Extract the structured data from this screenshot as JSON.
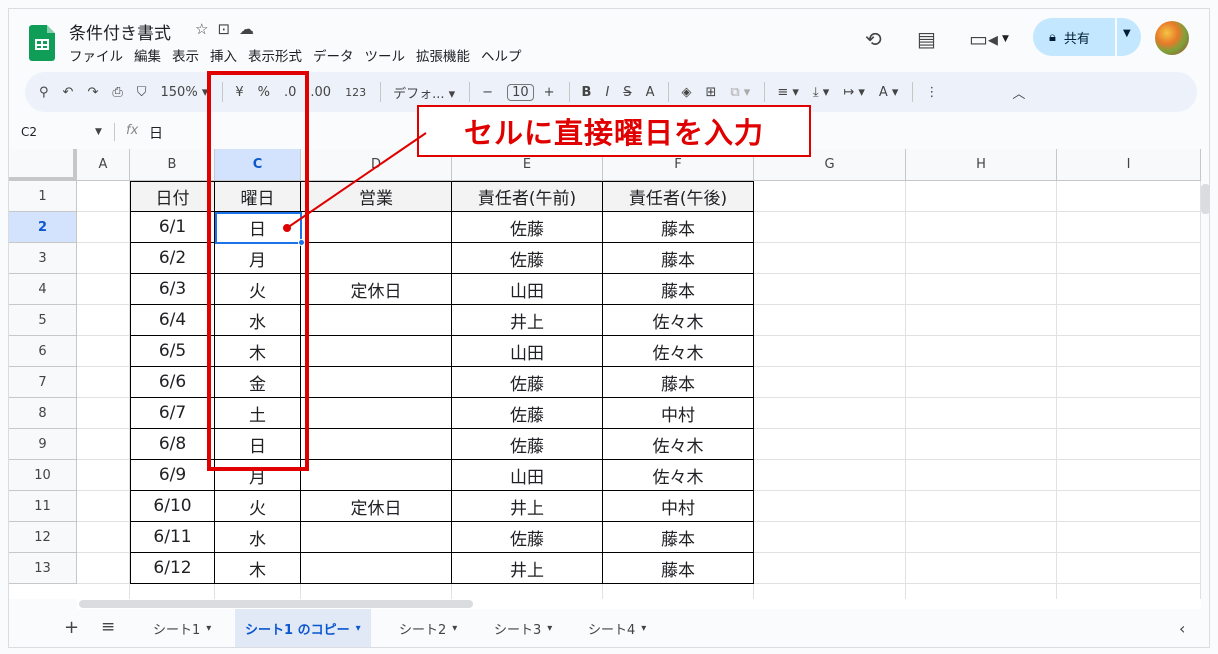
{
  "doc": {
    "title": "条件付き書式",
    "title_icons": [
      "star-icon",
      "move-folder-icon",
      "cloud-status-icon"
    ]
  },
  "menu": [
    "ファイル",
    "編集",
    "表示",
    "挿入",
    "表示形式",
    "データ",
    "ツール",
    "拡張機能",
    "ヘルプ"
  ],
  "share": {
    "label": "共有"
  },
  "toolbar": {
    "zoom": "150%",
    "currency": "¥",
    "percent": "%",
    "dec_minus": ".0",
    "dec_plus": ".00",
    "number_fmt": "123",
    "font": "デフォ...",
    "font_size": "10"
  },
  "formula": {
    "namebox": "C2",
    "fx": "fx",
    "value": "日"
  },
  "columns": [
    "A",
    "B",
    "C",
    "D",
    "E",
    "F",
    "G",
    "H",
    "I"
  ],
  "rows": [
    "1",
    "2",
    "3",
    "4",
    "5",
    "6",
    "7",
    "8",
    "9",
    "10",
    "11",
    "12",
    "13"
  ],
  "table": {
    "headers": [
      "日付",
      "曜日",
      "営業",
      "責任者(午前)",
      "責任者(午後)"
    ],
    "data": [
      [
        "6/1",
        "日",
        "",
        "佐藤",
        "藤本"
      ],
      [
        "6/2",
        "月",
        "",
        "佐藤",
        "藤本"
      ],
      [
        "6/3",
        "火",
        "定休日",
        "山田",
        "藤本"
      ],
      [
        "6/4",
        "水",
        "",
        "井上",
        "佐々木"
      ],
      [
        "6/5",
        "木",
        "",
        "山田",
        "佐々木"
      ],
      [
        "6/6",
        "金",
        "",
        "佐藤",
        "藤本"
      ],
      [
        "6/7",
        "土",
        "",
        "佐藤",
        "中村"
      ],
      [
        "6/8",
        "日",
        "",
        "佐藤",
        "佐々木"
      ],
      [
        "6/9",
        "月",
        "",
        "山田",
        "佐々木"
      ],
      [
        "6/10",
        "火",
        "定休日",
        "井上",
        "中村"
      ],
      [
        "6/11",
        "水",
        "",
        "佐藤",
        "藤本"
      ],
      [
        "6/12",
        "木",
        "",
        "井上",
        "藤本"
      ]
    ]
  },
  "annotation": {
    "label": "セルに直接曜日を入力",
    "color": "#e00000"
  },
  "sheets": [
    {
      "label": "シート1",
      "active": false
    },
    {
      "label": "シート1 のコピー",
      "active": true
    },
    {
      "label": "シート2",
      "active": false
    },
    {
      "label": "シート3",
      "active": false
    },
    {
      "label": "シート4",
      "active": false
    }
  ]
}
